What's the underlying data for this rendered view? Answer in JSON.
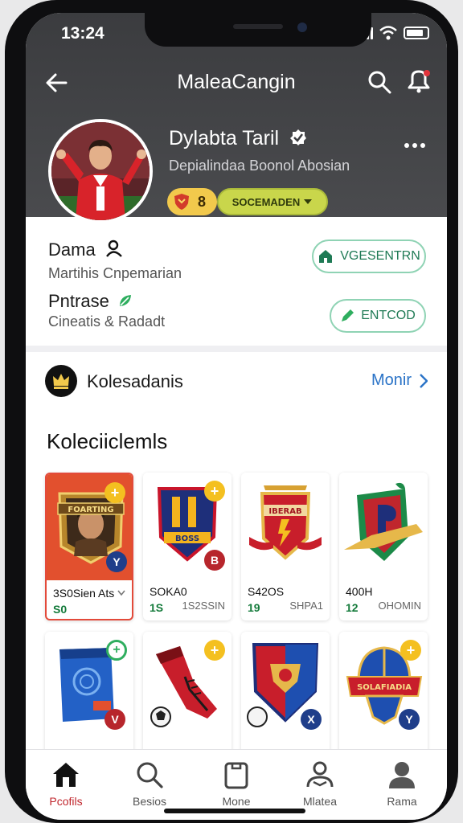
{
  "status": {
    "time": "13:24"
  },
  "appbar": {
    "title": "MaleaCangin"
  },
  "profile": {
    "name": "Dylabta Taril",
    "subtitle": "Depialindaa Boonol Abosian",
    "badge_count": "8",
    "level_label": "SOCEMADEN"
  },
  "rows": [
    {
      "label": "Dama",
      "sub": "Martihis Cnpemarian",
      "button": "VGESENTRN"
    },
    {
      "label": "Pntrase",
      "sub": "Cineatis & Radadt",
      "button": "ENTCOD"
    }
  ],
  "collection_header": {
    "title": "Kolesadanis",
    "more": "Monir"
  },
  "section": {
    "title": "Koleciiclemls"
  },
  "cards": [
    {
      "name": "3S0Sien Ats",
      "value": "S0",
      "price": "",
      "art": "player",
      "badge": "+",
      "chip": "Y"
    },
    {
      "name": "SOKA0",
      "value": "1S",
      "price": "1S2SSIN",
      "art": "shield-blue",
      "badge": "+",
      "chip": "B"
    },
    {
      "name": "S42OS",
      "value": "19",
      "price": "SHPA1",
      "art": "crest-red",
      "badge": "",
      "chip": ""
    },
    {
      "name": "400H",
      "value": "12",
      "price": "OHOMIN",
      "art": "shield-green",
      "badge": "",
      "chip": ""
    },
    {
      "name": "",
      "value": "",
      "price": "",
      "art": "box",
      "badge": "+",
      "chip": "V"
    },
    {
      "name": "",
      "value": "",
      "price": "",
      "art": "boot",
      "badge": "+",
      "chip": ""
    },
    {
      "name": "",
      "value": "",
      "price": "",
      "art": "crest-blue",
      "badge": "",
      "chip": "X"
    },
    {
      "name": "",
      "value": "",
      "price": "",
      "art": "helmet",
      "badge": "+",
      "chip": "Y"
    }
  ],
  "card_art_text": {
    "player": "FOARTING",
    "shield-blue": "BOSS",
    "crest-red": "IBERAB",
    "helmet": "SOLAFIADIA"
  },
  "tabs": [
    {
      "label": "Pcofils",
      "icon": "home-icon",
      "active": true
    },
    {
      "label": "Besios",
      "icon": "search-icon"
    },
    {
      "label": "Mone",
      "icon": "card-icon"
    },
    {
      "label": "Mlatea",
      "icon": "person-book-icon"
    },
    {
      "label": "Rama",
      "icon": "user-icon"
    }
  ],
  "colors": {
    "accent_red": "#c0262d",
    "accent_green": "#1f7a55",
    "link_blue": "#2a73c7",
    "badge_yellow": "#f2c94c"
  }
}
